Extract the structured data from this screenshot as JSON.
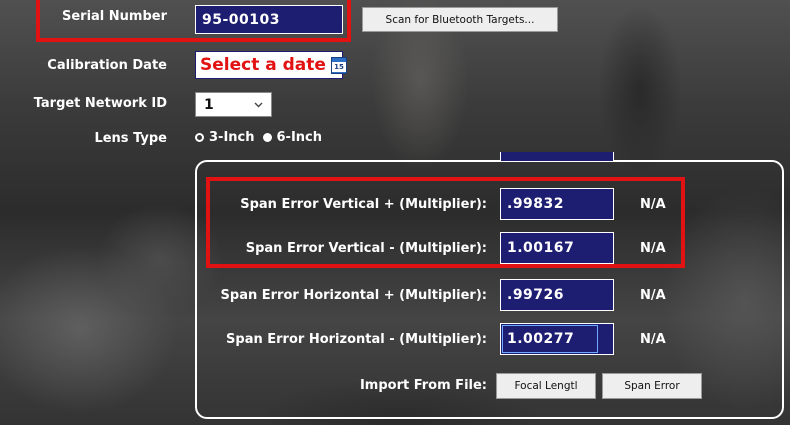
{
  "serial": {
    "label": "Serial Number",
    "value": "95-00103",
    "scan_button": "Scan for Bluetooth Targets..."
  },
  "calibration": {
    "label": "Calibration Date",
    "placeholder": "Select a date",
    "calendar_day": "15"
  },
  "network": {
    "label": "Target Network ID",
    "value": "1"
  },
  "lens": {
    "label": "Lens Type",
    "options": [
      "3-Inch",
      "6-Inch"
    ],
    "selected": "6-Inch"
  },
  "span": {
    "rows": [
      {
        "label": "Span Error Vertical + (Multiplier):",
        "value": ".99832",
        "status": "N/A"
      },
      {
        "label": "Span Error Vertical - (Multiplier):",
        "value": "1.00167",
        "status": "N/A"
      },
      {
        "label": "Span Error Horizontal + (Multiplier):",
        "value": ".99726",
        "status": "N/A"
      },
      {
        "label": "Span Error Horizontal - (Multiplier):",
        "value": "1.00277",
        "status": "N/A"
      }
    ]
  },
  "import": {
    "label": "Import From File:",
    "focal_button": "Focal Lengtl",
    "span_button": "Span Error"
  },
  "colors": {
    "field_bg": "#1d1d72",
    "highlight": "#e21212"
  }
}
